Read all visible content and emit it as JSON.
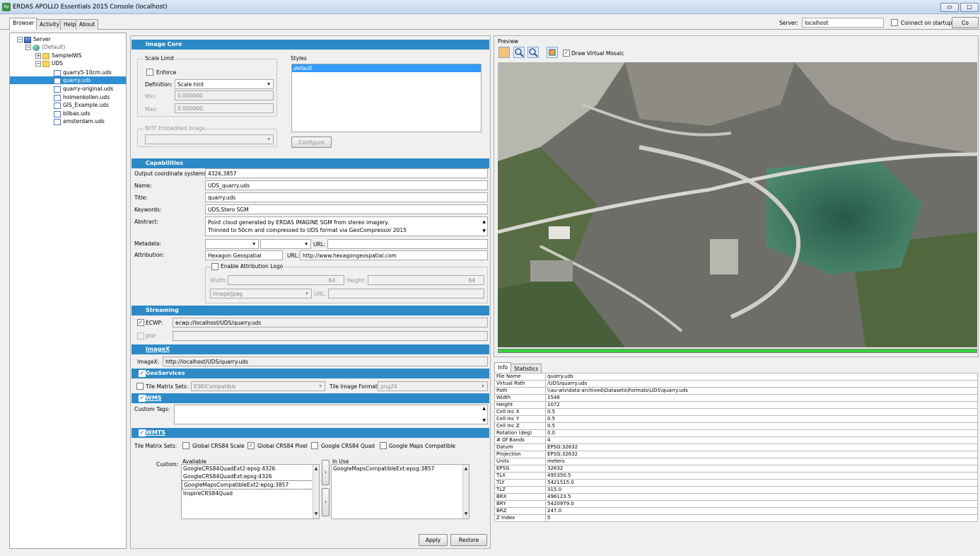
{
  "window": {
    "title": "ERDAS APOLLO Essentials 2015 Console (localhost)",
    "app_icon": "Ap"
  },
  "tabs": [
    {
      "label": "Browser",
      "selected": true
    },
    {
      "label": "Activity"
    },
    {
      "label": "Help"
    },
    {
      "label": "About"
    }
  ],
  "server": {
    "label": "Server:",
    "value": "localhost",
    "connect_label": "Connect on startup",
    "connect_button": "Co"
  },
  "tree": {
    "root": "Server",
    "default": "(Default)",
    "folders": [
      "SampleIWS",
      "UDS"
    ],
    "files": [
      "quarry5-10cm.uds",
      "quarry.uds",
      "quarry-original.uds",
      "holmenkollen.uds",
      "GIS_Example.uds",
      "bilbao.uds",
      "amsterdam.uds"
    ],
    "selected": "quarry.uds"
  },
  "image_core": {
    "header": "Image Core",
    "scale_limit": "Scale Limit",
    "enforce": "Enforce",
    "definition_label": "Definition:",
    "definition_value": "Scale hint",
    "min_label": "Min:",
    "min_value": "0.000000",
    "max_label": "Max:",
    "max_value": "0.000000",
    "nitf_label": "NITF Embedded Image",
    "styles_label": "Styles",
    "styles_item": "default",
    "configure": "Configure"
  },
  "capabilities": {
    "header": "Capabilities",
    "ocs_label": "Output coordinate systems:",
    "ocs": "4326,3857",
    "name_label": "Name:",
    "name": "UDS_quarry.uds",
    "title_label": "Title:",
    "title": "quarry.uds",
    "keywords_label": "Keywords:",
    "keywords": "UDS,Stero SGM",
    "abstract_label": "Abstract:",
    "abstract_1": "Point cloud generated by ERDAS IMAGINE SGM from stereo imagery.",
    "abstract_2": "Thinned to 50cm and compressed to UDS format via GeoCompressor 2015",
    "metadata_label": "Metadata:",
    "url_label": "URL:",
    "attribution_label": "Attribution:",
    "attribution": "Hexagon Geospatial",
    "attribution_url": "http://www.hexagongeospatial.com",
    "enable_logo": "Enable Attribution Logo",
    "width_label": "Width:",
    "width": "64",
    "height_label": "Height:",
    "height": "64",
    "format": "image/jpeg"
  },
  "streaming": {
    "header": "Streaming",
    "ecwp_label": "ECWP:",
    "ecwp": "ecwp://localhost/UDS/quarry.uds",
    "jpip_label": "JPIP:"
  },
  "imagex": {
    "header": "ImageX",
    "label": "ImageX:",
    "value": "http://localhost/UDS/quarry.uds"
  },
  "geoservices": {
    "header": "GeoServices",
    "tms_label": "Tile Matrix Sets:",
    "tms_value": "ESRICompatible",
    "format_label": "Tile Image Format:",
    "format_value": "png24"
  },
  "wms": {
    "header": "WMS",
    "custom_tags": "Custom Tags:"
  },
  "wmts": {
    "header": "WMTS",
    "tms_label": "Tile Matrix Sets:",
    "options": [
      "Global CRS84 Scale",
      "Global CRS84 Pixel",
      "Google CRS84 Quad",
      "Google Maps Compatible"
    ],
    "checked": [
      false,
      true,
      false,
      false
    ],
    "custom_label": "Custom:",
    "available_label": "Available",
    "available": [
      "GoogleCRS84QuadExt2:epsg:4326",
      "GoogleCRS84QuadExt:epsg:4326",
      "GoogleMapsCompatibleExt2:epsg:3857",
      "InspireCRS84Quad"
    ],
    "inuse_label": "In Use",
    "inuse": [
      "GoogleMapsCompatibleExt:epsg:3857"
    ]
  },
  "actions": {
    "apply": "Apply",
    "restore": "Restore"
  },
  "preview": {
    "label": "Preview",
    "draw_mosaic": "Draw Virtual Mosaic",
    "progress": 1.0
  },
  "info_tabs": [
    "Info",
    "Statistics"
  ],
  "info": [
    [
      "File Name",
      "quarry.uds"
    ],
    [
      "Virtual Path",
      "/UDS/quarry.uds"
    ],
    [
      "Path",
      "\\\\au-wlv\\data-archived\\Datasets\\Formats\\UDS\\quarry.uds"
    ],
    [
      "Width",
      "1546"
    ],
    [
      "Height",
      "1072"
    ],
    [
      "Cell Inc X",
      "0.5"
    ],
    [
      "Cell Inc Y",
      "0.5"
    ],
    [
      "Cell Inc Z",
      "0.5"
    ],
    [
      "Rotation (deg)",
      "0.0"
    ],
    [
      "# Of Bands",
      "4"
    ],
    [
      "Datum",
      "EPSG:32632"
    ],
    [
      "Projection",
      "EPSG:32632"
    ],
    [
      "Units",
      "meters"
    ],
    [
      "EPSG",
      "32632"
    ],
    [
      "TLX",
      "495350.5"
    ],
    [
      "TLY",
      "5421515.0"
    ],
    [
      "TLZ",
      "315.0"
    ],
    [
      "BRX",
      "496123.5"
    ],
    [
      "BRY",
      "5420979.0"
    ],
    [
      "BRZ",
      "247.0"
    ],
    [
      "Z Index",
      "5"
    ]
  ],
  "colors": {
    "section": "#2d8ac6",
    "selection": "#2f8fd0",
    "progress": "#34d23a"
  }
}
